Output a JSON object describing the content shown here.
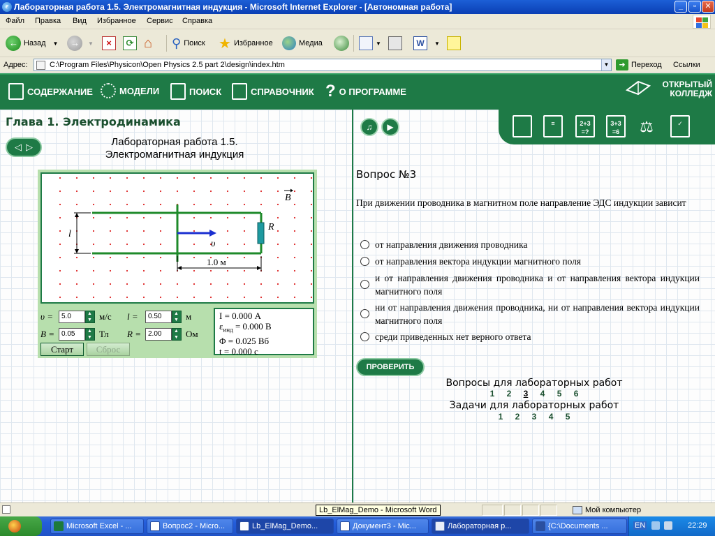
{
  "window": {
    "title": "Лабораторная работа 1.5. Электромагнитная индукция - Microsoft Internet Explorer - [Автономная работа]"
  },
  "menu": [
    "Файл",
    "Правка",
    "Вид",
    "Избранное",
    "Сервис",
    "Справка"
  ],
  "toolbar": {
    "back_label": "Назад",
    "search_label": "Поиск",
    "favorites_label": "Избранное",
    "media_label": "Медиа"
  },
  "address": {
    "label": "Адрес:",
    "url": "C:\\Program Files\\Physicon\\Open Physics 2.5 part 2\\design\\index.htm",
    "go_label": "Переход",
    "links_label": "Ссылки"
  },
  "app_nav": {
    "items": [
      "СОДЕРЖАНИЕ",
      "МОДЕЛИ",
      "ПОИСК",
      "СПРАВОЧНИК",
      "О ПРОГРАММЕ"
    ],
    "brand_line1": "ОТКРЫТЫЙ",
    "brand_line2": "КОЛЛЕДЖ"
  },
  "left": {
    "chapter": "Глава 1. Электродинамика",
    "lab_line1": "Лабораторная работа 1.5.",
    "lab_line2": "Электромагнитная индукция"
  },
  "sim": {
    "label_B": "B",
    "label_l": "l",
    "label_R": "R",
    "label_v": "υ",
    "distance": "1.0 м",
    "v_label": "υ =",
    "v_value": "5.0",
    "v_unit": "м/с",
    "l_label": "l =",
    "l_value": "0.50",
    "l_unit": "м",
    "B_label": "B =",
    "B_value": "0.05",
    "B_unit": "Тл",
    "R_label": "R =",
    "R_value": "2.00",
    "R_unit": "Ом",
    "start_label": "Старт",
    "reset_label": "Сброс",
    "readout": {
      "I": "I = 0.000 А",
      "eps": "= 0.000 В",
      "eps_sym": "ε",
      "eps_sub": "инд",
      "phi": "Φ = 0.025 Вб",
      "t": "t = 0.000 с"
    }
  },
  "right": {
    "tools": [
      "",
      "",
      "2+3\n=?",
      "3+3\n=6",
      "",
      ""
    ],
    "question_number": "Вопрос №3",
    "question_text": "При движении проводника в магнитном поле направление ЭДС индукции зависит",
    "answers": [
      "от направления движения проводника",
      "от направления вектора индукции магнитного поля",
      "и от направления движения проводника и от направления вектора индукции магнитного поля",
      "ни от направления движения проводника, ни от направления вектора индукции магнитного поля",
      "среди приведенных нет верного ответа"
    ],
    "check_label": "ПРОВЕРИТЬ",
    "questions_title": "Вопросы для лабораторных работ",
    "question_links": [
      "1",
      "2",
      "3",
      "4",
      "5",
      "6"
    ],
    "current_question": "3",
    "tasks_title": "Задачи для лабораторных работ",
    "task_links": [
      "1",
      "2",
      "3",
      "4",
      "5"
    ]
  },
  "status": {
    "zone": "Мой компьютер",
    "tooltip": "Lb_ElMag_Demo - Microsoft Word"
  },
  "taskbar": {
    "tasks": [
      "Microsoft Excel - ...",
      "Вопрос2 - Micro...",
      "Lb_ElMag_Demo...",
      "Документ3 - Mic...",
      "Лабораторная р...",
      "{C:\\Documents ..."
    ],
    "lang": "EN",
    "clock": "22:29"
  }
}
